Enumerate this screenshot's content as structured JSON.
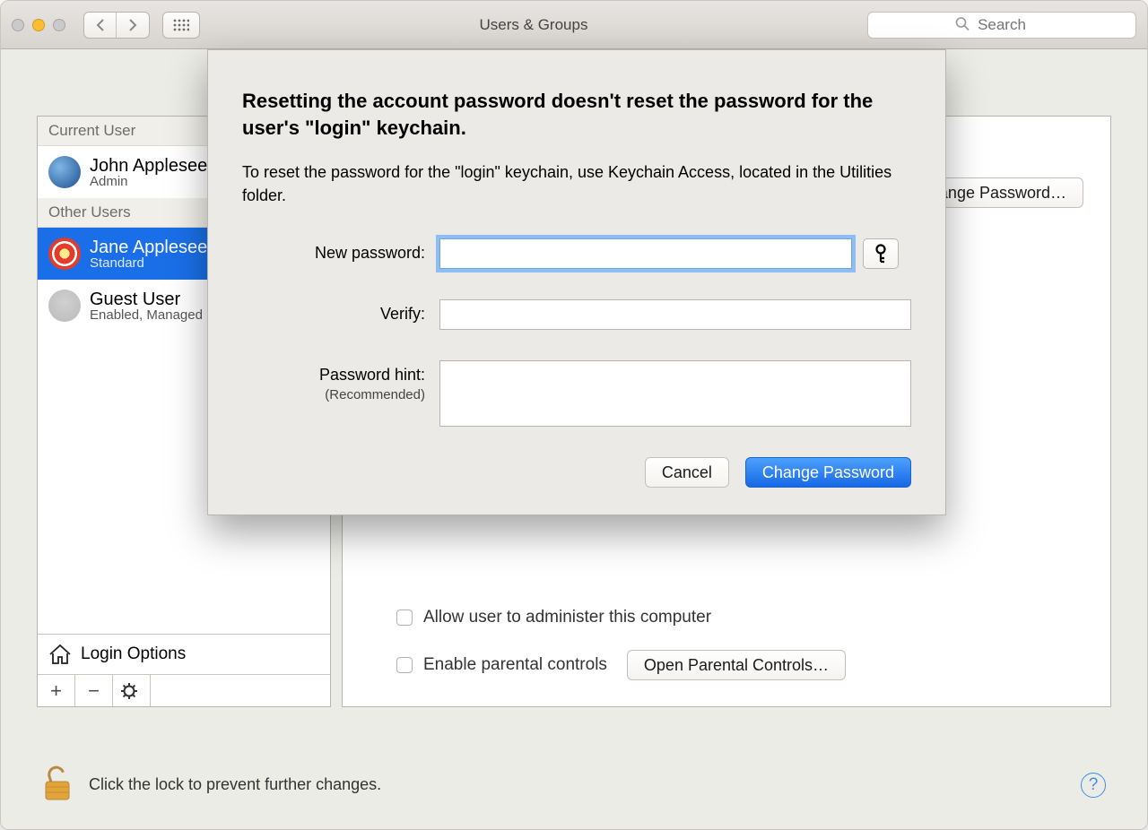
{
  "window": {
    "title": "Users & Groups",
    "search_placeholder": "Search"
  },
  "sidebar": {
    "current_user_header": "Current User",
    "other_users_header": "Other Users",
    "current_user": {
      "name": "John Appleseed",
      "role": "Admin"
    },
    "users": [
      {
        "name": "Jane Appleseed",
        "role": "Standard",
        "selected": true
      },
      {
        "name": "Guest User",
        "role": "Enabled, Managed"
      }
    ],
    "login_options_label": "Login Options"
  },
  "right_panel": {
    "change_password_btn": "Change Password…",
    "allow_admin_label": "Allow user to administer this computer",
    "enable_parental_label": "Enable parental controls",
    "open_parental_btn": "Open Parental Controls…"
  },
  "sheet": {
    "heading": "Resetting the account password doesn't reset the password for the user's \"login\" keychain.",
    "description": "To reset the password for the \"login\" keychain, use Keychain Access, located in the Utilities folder.",
    "new_password_label": "New password:",
    "verify_label": "Verify:",
    "hint_label": "Password hint:",
    "hint_sub": "(Recommended)",
    "new_password_value": "",
    "verify_value": "",
    "hint_value": "",
    "cancel": "Cancel",
    "change_password": "Change Password"
  },
  "footer": {
    "lock_text": "Click the lock to prevent further changes."
  }
}
